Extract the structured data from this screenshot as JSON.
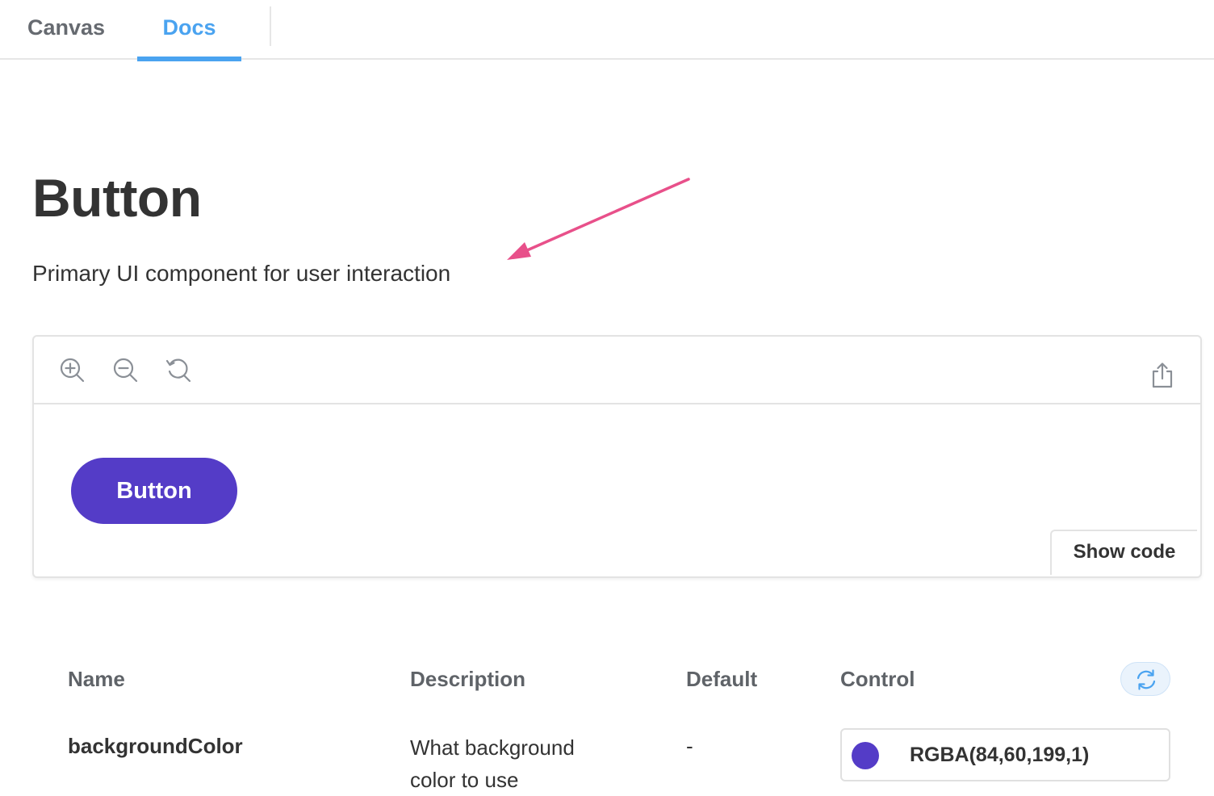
{
  "tabs": [
    {
      "label": "Canvas",
      "active": false
    },
    {
      "label": "Docs",
      "active": true
    }
  ],
  "colors": {
    "accent": "#4aa3f0",
    "button_primary": "#543cc7",
    "annotation_arrow": "#e8508a"
  },
  "doc": {
    "title": "Button",
    "description": "Primary UI component for user interaction"
  },
  "preview": {
    "toolbar_icons": [
      "zoom-in-icon",
      "zoom-out-icon",
      "reset-zoom-icon",
      "share-icon"
    ],
    "demo_button_label": "Button",
    "show_code_label": "Show code"
  },
  "args_table": {
    "headers": {
      "name": "Name",
      "description": "Description",
      "default": "Default",
      "control": "Control"
    },
    "reset_icon": "refresh-icon",
    "rows": [
      {
        "name": "backgroundColor",
        "description": "What background color to use",
        "default": "-",
        "control_value": "RGBA(84,60,199,1)",
        "swatch_color": "#543cc7"
      }
    ]
  }
}
